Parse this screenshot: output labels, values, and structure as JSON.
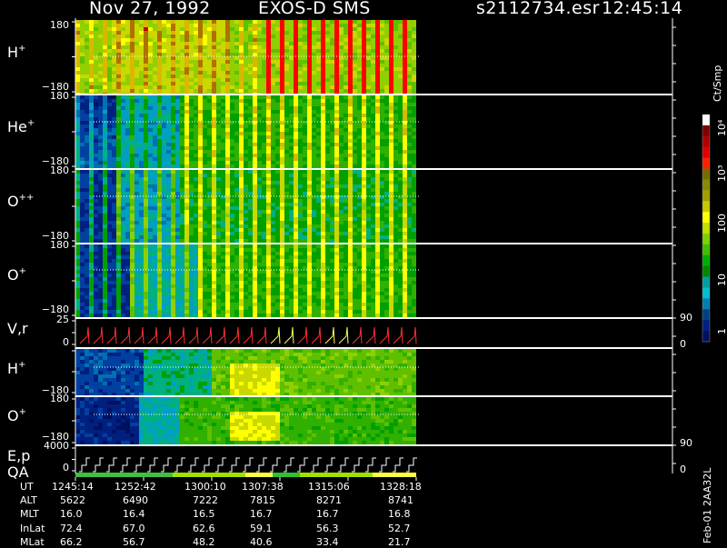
{
  "header": {
    "date": "Nov 27, 1992",
    "instrument": "EXOS-D SMS",
    "file": "s2112734.esr",
    "time": "12:45:14"
  },
  "panels": [
    {
      "id": "h-plus-angle",
      "species": "H",
      "charge": "+",
      "y_top": "180",
      "y_bottom": "−180"
    },
    {
      "id": "he-plus-angle",
      "species": "He",
      "charge": "+",
      "y_top": "180",
      "y_bottom": "−180"
    },
    {
      "id": "o-plusplus-angle",
      "species": "O",
      "charge": "++",
      "y_top": "180",
      "y_bottom": "−180"
    },
    {
      "id": "o-plus-angle",
      "species": "O",
      "charge": "+",
      "y_top": "180",
      "y_bottom": "−180"
    },
    {
      "id": "vr",
      "species": "V,r",
      "charge": "",
      "y_top": "25",
      "y_bottom": "0",
      "right_top": "90",
      "right_bottom": "0"
    },
    {
      "id": "h-plus-2",
      "species": "H",
      "charge": "+",
      "y_top": "",
      "y_bottom": "−180"
    },
    {
      "id": "o-plus-2",
      "species": "O",
      "charge": "+",
      "y_top": "180",
      "y_bottom": "−180"
    },
    {
      "id": "ep-qa",
      "species": "E,p",
      "species2": "QA",
      "charge": "",
      "y_top": "4000",
      "y_bottom": "0",
      "right_top": "90",
      "right_bottom": "0"
    }
  ],
  "colorbar": {
    "unit": "Ct/Smp",
    "labels": [
      "10⁴",
      "10³",
      "100",
      "10",
      "1"
    ],
    "colors": [
      "#ffffff",
      "#800000",
      "#b00000",
      "#e00000",
      "#ff2000",
      "#7a6a00",
      "#8a8a00",
      "#a0a000",
      "#c8c800",
      "#ffff00",
      "#c0e000",
      "#80d000",
      "#40c000",
      "#00b000",
      "#008800",
      "#00a0a0",
      "#00c0d0",
      "#0080b0",
      "#004080",
      "#002080",
      "#001060"
    ]
  },
  "footer": {
    "rows": [
      {
        "label": "UT",
        "values": [
          "1245:14",
          "1252:42",
          "1300:10",
          "1307:38",
          "1315:06",
          "1328:18"
        ]
      },
      {
        "label": "ALT",
        "values": [
          "5622",
          "6490",
          "7222",
          "7815",
          "8271",
          "8741"
        ]
      },
      {
        "label": "MLT",
        "values": [
          "16.0",
          "16.4",
          "16.5",
          "16.7",
          "16.7",
          "16.8"
        ]
      },
      {
        "label": "InLat",
        "values": [
          "72.4",
          "67.0",
          "62.6",
          "59.1",
          "56.3",
          "52.7"
        ]
      },
      {
        "label": "MLat",
        "values": [
          "66.2",
          "56.7",
          "48.2",
          "40.6",
          "33.4",
          "21.7"
        ]
      }
    ],
    "side_text": "Feb-01 2AA32L"
  },
  "chart_data": {
    "type": "heatmap",
    "x_label": "UT",
    "x_ticks": [
      "1245:14",
      "1252:42",
      "1300:10",
      "1307:38",
      "1315:06",
      "1328:18"
    ],
    "panels": [
      "H+",
      "He+",
      "O++",
      "O+",
      "V,r",
      "H+",
      "O+",
      "E,p QA"
    ],
    "colorbar_unit": "Ct/Smp",
    "colorbar_ticks": [
      "1",
      "10",
      "100",
      "10^3",
      "10^4"
    ]
  }
}
